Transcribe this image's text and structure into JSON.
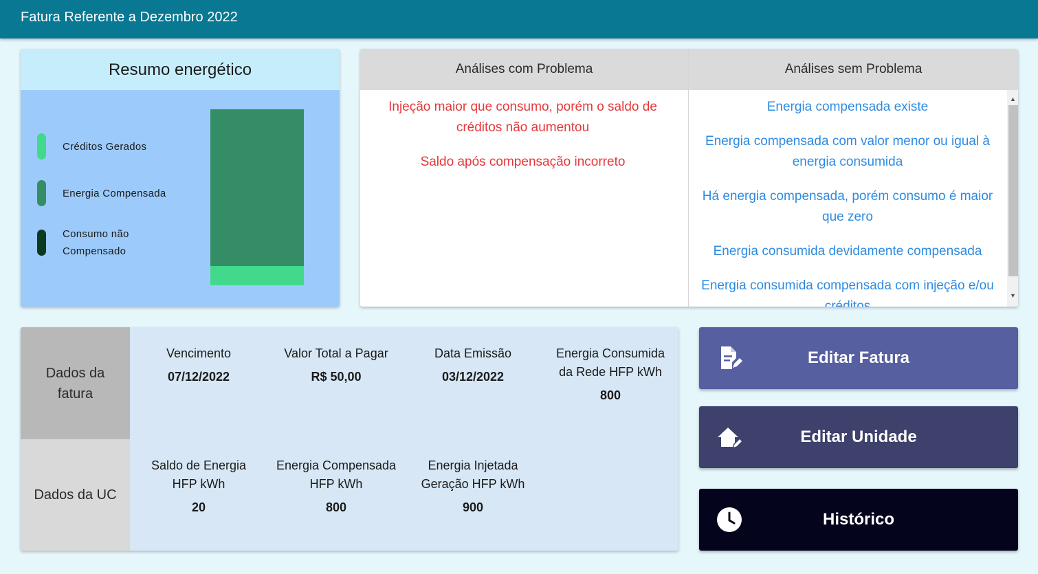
{
  "header": {
    "title": "Fatura Referente a Dezembro 2022"
  },
  "resumo": {
    "title": "Resumo energético",
    "legend": [
      {
        "label": "Créditos Gerados",
        "color": "#43d98d"
      },
      {
        "label": "Energia Compensada",
        "color": "#358d66"
      },
      {
        "label": "Consumo não Compensado",
        "label_line1": "Consumo não",
        "label_line2": "Compensado",
        "color": "#0c3a21"
      }
    ],
    "bar": {
      "energia_compensada_fraction": 0.89,
      "creditos_gerados_fraction": 0.11,
      "consumo_nao_compensado_fraction": 0
    }
  },
  "analises": {
    "com_problema": {
      "header": "Análises com Problema",
      "color": "#e5383b",
      "items": [
        "Injeção maior que consumo, porém o saldo de créditos não aumentou",
        "Saldo após compensação incorreto"
      ]
    },
    "sem_problema": {
      "header": "Análises sem Problema",
      "color": "#2f8be0",
      "items": [
        "Energia compensada existe",
        "Energia compensada com valor menor ou igual à energia consumida",
        "Há energia compensada, porém consumo é maior que zero",
        "Energia consumida devidamente compensada",
        "Energia consumida compensada com injeção e/ou créditos"
      ]
    }
  },
  "dados_fatura": {
    "label": "Dados da fatura",
    "fields": [
      {
        "label": "Vencimento",
        "value": "07/12/2022"
      },
      {
        "label": "Valor Total a Pagar",
        "value": "R$ 50,00"
      },
      {
        "label": "Data Emissão",
        "value": "03/12/2022"
      },
      {
        "label": "Energia Consumida da Rede HFP kWh",
        "value": "800"
      }
    ]
  },
  "dados_uc": {
    "label": "Dados da UC",
    "fields": [
      {
        "label": "Saldo de Energia HFP kWh",
        "value": "20"
      },
      {
        "label": "Energia Compensada HFP kWh",
        "value": "800"
      },
      {
        "label": "Energia Injetada Geração HFP kWh",
        "value": "900"
      }
    ]
  },
  "buttons": {
    "editar_fatura": {
      "label": "Editar Fatura",
      "icon": "edit-document-icon",
      "color": "#565f9f"
    },
    "editar_unidade": {
      "label": "Editar Unidade",
      "icon": "edit-home-icon",
      "color": "#3d416b"
    },
    "historico": {
      "label": "Histórico",
      "icon": "clock-icon",
      "color": "#04041d"
    }
  }
}
